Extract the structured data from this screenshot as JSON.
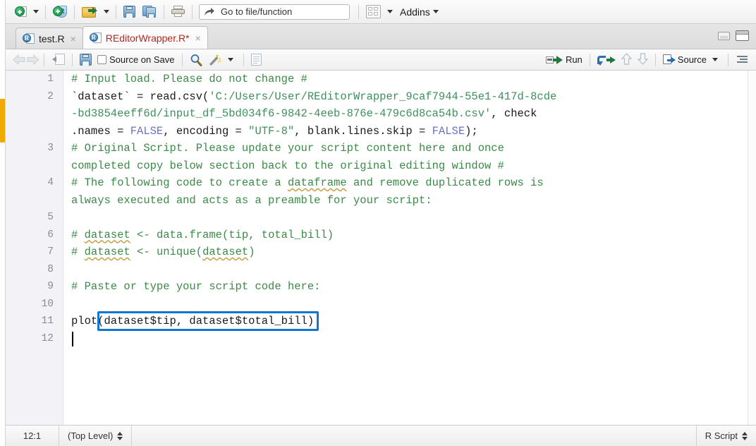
{
  "main_toolbar": {
    "new_file_icon": "new-file-icon",
    "new_file_caret": "chevron-down-icon",
    "new_project_icon": "new-project-icon",
    "open_file_icon": "open-folder-icon",
    "open_file_caret": "chevron-down-icon",
    "save_icon": "save-icon",
    "save_all_icon": "save-all-icon",
    "print_icon": "print-icon",
    "goto": {
      "icon": "goto-arrow-icon",
      "placeholder": "Go to file/function",
      "value": "Go to file/function"
    },
    "panes_icon": "workspace-panes-icon",
    "panes_caret": "chevron-down-icon",
    "addins_label": "Addins",
    "addins_caret": "chevron-down-icon"
  },
  "tabs": [
    {
      "label": "test.R",
      "icon": "r-script-file-icon",
      "close": "×",
      "active": false,
      "modified": false
    },
    {
      "label": "REditorWrapper.R*",
      "icon": "r-script-file-icon",
      "close": "×",
      "active": true,
      "modified": true
    }
  ],
  "window_controls": {
    "minimize": "minimize-icon",
    "maximize": "maximize-icon"
  },
  "editor_toolbar": {
    "back_icon": "back-arrow-icon",
    "forward_icon": "forward-arrow-icon",
    "popout_icon": "show-in-new-window-icon",
    "save_icon": "save-icon",
    "source_on_save_label": "Source on Save",
    "source_on_save_checked": false,
    "find_icon": "search-icon",
    "magic_icon": "code-tools-magic-wand-icon",
    "magic_caret": "chevron-down-icon",
    "compile_report_icon": "compile-report-icon",
    "run_label": "Run",
    "run_icon": "run-icon",
    "rerun_icon": "re-run-previous-icon",
    "up_icon": "go-up-chunk-icon",
    "down_icon": "go-down-chunk-icon",
    "source_label": "Source",
    "source_icon": "source-icon",
    "source_caret": "chevron-down-icon",
    "outline_icon": "document-outline-icon"
  },
  "code": {
    "lines": [
      {
        "num": "1",
        "segments": [
          {
            "text": "# Input load. Please do not change #",
            "cls": "cmt"
          }
        ]
      },
      {
        "num": "2",
        "segments": [
          {
            "text": "`dataset` = read.csv(",
            "cls": ""
          },
          {
            "text": "'C:/Users/User/REditorWrapper_9caf7944-55e1-417d-8cde",
            "cls": "str"
          }
        ]
      },
      {
        "num": "",
        "segments": [
          {
            "text": "-bd3854eeff6d/input_df_5bd034f6-9842-4eeb-876e-479c6d8ca54b.csv'",
            "cls": "str"
          },
          {
            "text": ", check",
            "cls": ""
          }
        ]
      },
      {
        "num": "",
        "segments": [
          {
            "text": ".names = ",
            "cls": ""
          },
          {
            "text": "FALSE",
            "cls": "cst"
          },
          {
            "text": ", encoding = ",
            "cls": ""
          },
          {
            "text": "\"UTF-8\"",
            "cls": "str"
          },
          {
            "text": ", blank.lines.skip = ",
            "cls": ""
          },
          {
            "text": "FALSE",
            "cls": "cst"
          },
          {
            "text": ");",
            "cls": ""
          }
        ]
      },
      {
        "num": "3",
        "segments": [
          {
            "text": "# Original Script. Please update your script content here and once",
            "cls": "cmt"
          }
        ]
      },
      {
        "num": "",
        "segments": [
          {
            "text": "completed copy below section back to the original editing window #",
            "cls": "cmt"
          }
        ]
      },
      {
        "num": "4",
        "segments": [
          {
            "text": "# The following code to create a ",
            "cls": "cmt"
          },
          {
            "text": "dataframe",
            "cls": "cmt spell"
          },
          {
            "text": " and remove duplicated rows is",
            "cls": "cmt"
          }
        ]
      },
      {
        "num": "",
        "segments": [
          {
            "text": "always executed and acts as a preamble for your script:",
            "cls": "cmt"
          }
        ]
      },
      {
        "num": "5",
        "segments": [
          {
            "text": "",
            "cls": ""
          }
        ]
      },
      {
        "num": "6",
        "segments": [
          {
            "text": "# ",
            "cls": "cmt"
          },
          {
            "text": "dataset",
            "cls": "cmt spell"
          },
          {
            "text": " <- data.frame(tip, total_bill)",
            "cls": "cmt"
          }
        ]
      },
      {
        "num": "7",
        "segments": [
          {
            "text": "# ",
            "cls": "cmt"
          },
          {
            "text": "dataset",
            "cls": "cmt spell"
          },
          {
            "text": " <- unique(",
            "cls": "cmt"
          },
          {
            "text": "dataset",
            "cls": "cmt spell"
          },
          {
            "text": ")",
            "cls": "cmt"
          }
        ]
      },
      {
        "num": "8",
        "segments": [
          {
            "text": "",
            "cls": ""
          }
        ]
      },
      {
        "num": "9",
        "segments": [
          {
            "text": "# Paste or type your script code here:",
            "cls": "cmt"
          }
        ]
      },
      {
        "num": "10",
        "segments": [
          {
            "text": "",
            "cls": ""
          }
        ]
      },
      {
        "num": "11",
        "segments": [
          {
            "text": "plot(dataset$tip, dataset$total_bill)",
            "cls": ""
          }
        ]
      },
      {
        "num": "12",
        "segments": [
          {
            "text": "",
            "cls": ""
          }
        ]
      }
    ],
    "highlight": {
      "name": "selection-highlight-box",
      "color": "#1177d1",
      "text": "(dataset$tip, dataset$total_bill)"
    }
  },
  "status_bar": {
    "cursor_position": "12:1",
    "scope": "(Top Level)",
    "scope_spinner": "up-down-spinner-icon",
    "file_type": "R Script",
    "file_type_spinner": "up-down-spinner-icon"
  }
}
